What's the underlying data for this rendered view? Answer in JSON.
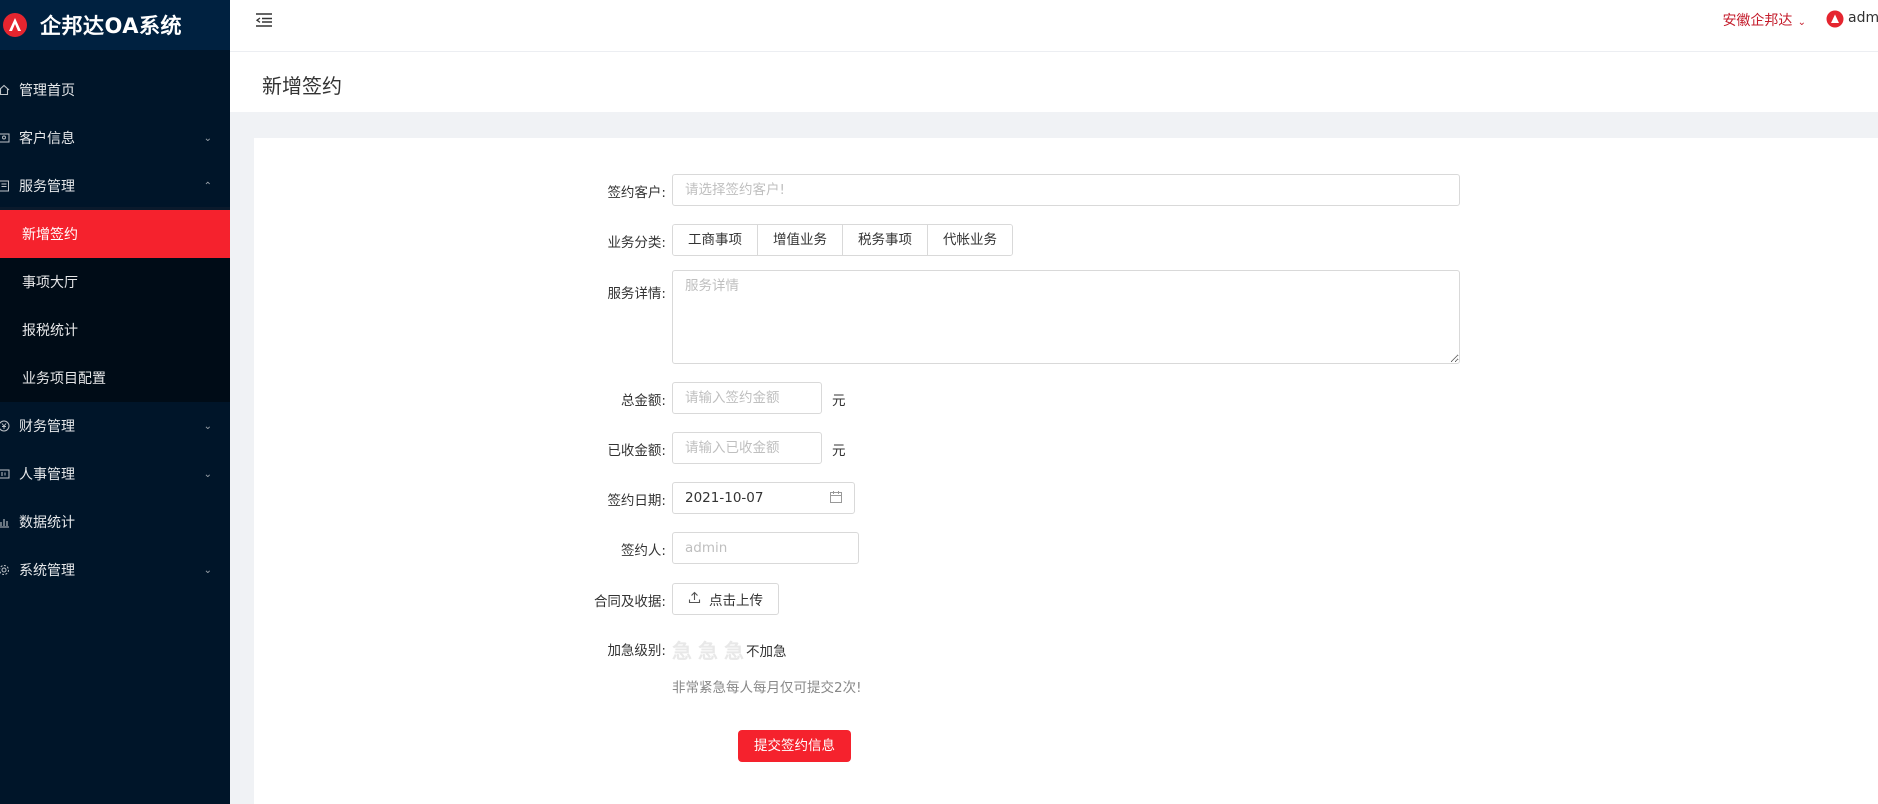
{
  "app": {
    "title": "企邦达OA系统"
  },
  "sidebar": {
    "items": [
      {
        "label": "管理首页",
        "icon": "home-icon"
      },
      {
        "label": "客户信息",
        "icon": "customer-icon",
        "expandable": true
      },
      {
        "label": "服务管理",
        "icon": "service-icon",
        "expanded": true,
        "children": [
          {
            "label": "新增签约",
            "active": true
          },
          {
            "label": "事项大厅"
          },
          {
            "label": "报税统计"
          },
          {
            "label": "业务项目配置"
          }
        ]
      },
      {
        "label": "财务管理",
        "icon": "finance-icon",
        "expandable": true
      },
      {
        "label": "人事管理",
        "icon": "hr-icon",
        "expandable": true
      },
      {
        "label": "数据统计",
        "icon": "chart-icon"
      },
      {
        "label": "系统管理",
        "icon": "settings-icon",
        "expandable": true
      }
    ]
  },
  "header": {
    "company": "安徽企邦达",
    "user": "admin"
  },
  "page": {
    "title": "新增签约"
  },
  "form": {
    "customer": {
      "label": "签约客户:",
      "placeholder": "请选择签约客户!"
    },
    "category": {
      "label": "业务分类:",
      "options": [
        "工商事项",
        "增值业务",
        "税务事项",
        "代帐业务"
      ]
    },
    "details": {
      "label": "服务详情:",
      "placeholder": "服务详情"
    },
    "total": {
      "label": "总金额:",
      "placeholder": "请输入签约金额",
      "unit": "元"
    },
    "received": {
      "label": "已收金额:",
      "placeholder": "请输入已收金额",
      "unit": "元"
    },
    "date": {
      "label": "签约日期:",
      "value": "2021-10-07"
    },
    "signer": {
      "label": "签约人:",
      "placeholder": "admin"
    },
    "contract": {
      "label": "合同及收据:",
      "button": "点击上传"
    },
    "urgency": {
      "label": "加急级别:",
      "stars": [
        "急",
        "急",
        "急"
      ],
      "value_text": "不加急",
      "hint": "非常紧急每人每月仅可提交2次!"
    },
    "submit": "提交签约信息"
  },
  "colors": {
    "accent": "#f5222d",
    "sidebar": "#001529",
    "company_text": "#c41d2c"
  }
}
